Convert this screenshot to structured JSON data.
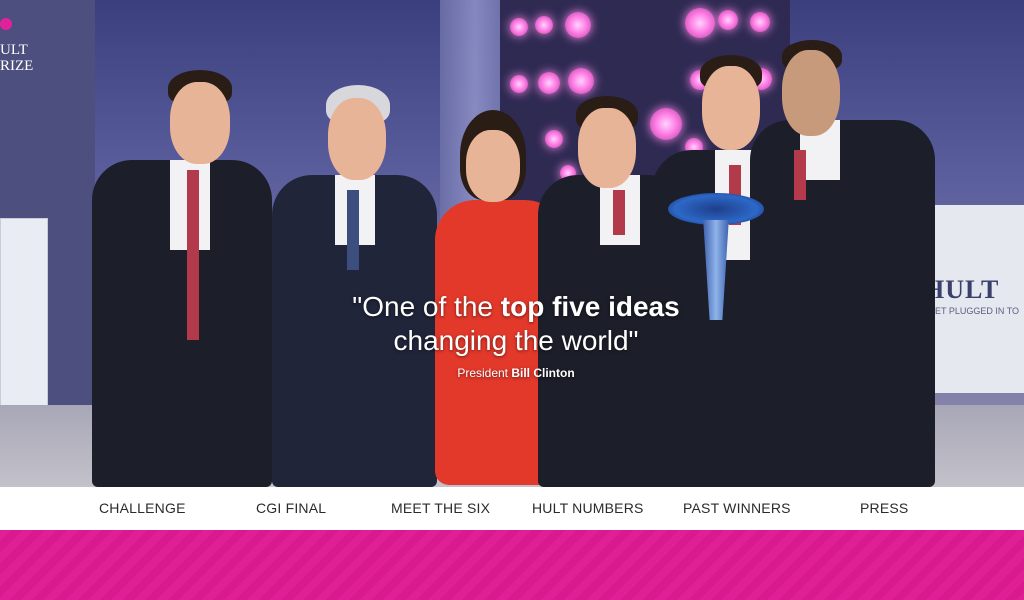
{
  "brand": {
    "name": "HULT PRIZE",
    "logo_text_line1": "ULT",
    "logo_text_line2": "RIZE",
    "accent_color": "#e01f96"
  },
  "backdrop": {
    "panel_logo": "HULT",
    "panel_subtitle": "GET PLUGGED IN TO"
  },
  "hero": {
    "quote_open": "\"One of the ",
    "quote_bold": "top five ideas",
    "quote_line2": "changing the world\"",
    "attribution_prefix": "President ",
    "attribution_name": "Bill Clinton"
  },
  "nav": {
    "items": [
      {
        "label": "CHALLENGE"
      },
      {
        "label": "CGI FINAL"
      },
      {
        "label": "MEET THE SIX"
      },
      {
        "label": "HULT NUMBERS"
      },
      {
        "label": "PAST WINNERS"
      },
      {
        "label": "PRESS"
      }
    ]
  },
  "colors": {
    "banner": "#e01f96",
    "nav_text": "#2b2b2b",
    "nav_bg": "#ffffff"
  }
}
